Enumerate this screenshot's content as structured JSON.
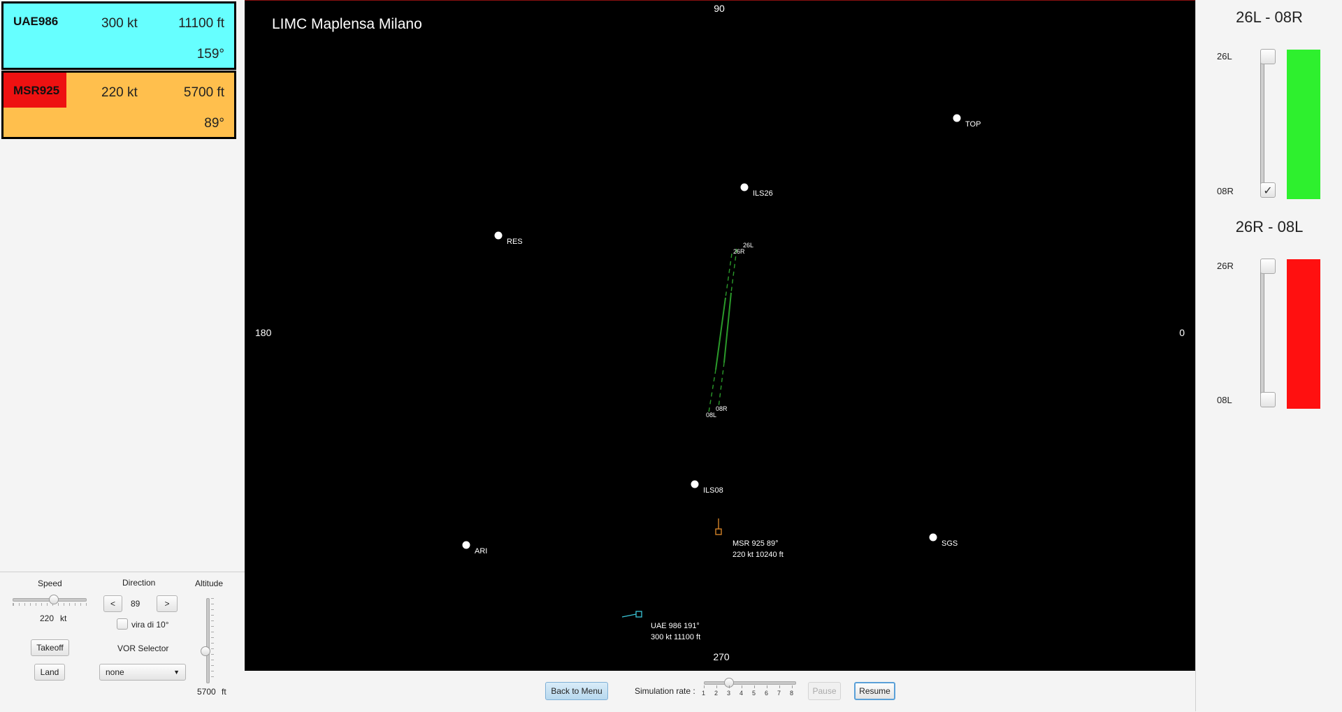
{
  "strips": [
    {
      "callsign": "UAE986",
      "speed": "300 kt",
      "altitude": "11100 ft",
      "heading": "159°",
      "bg": "#66ffff",
      "callsign_bg": "#66ffff"
    },
    {
      "callsign": "MSR925",
      "speed": "220 kt",
      "altitude": "5700 ft",
      "heading": "89°",
      "bg": "#ffbf4d",
      "callsign_bg": "#ee1111"
    }
  ],
  "controls": {
    "speed_label": "Speed",
    "speed_value": "220",
    "speed_unit": "kt",
    "direction_label": "Direction",
    "direction_value": "89",
    "direction_dec": "<",
    "direction_inc": ">",
    "turn10_label": "vira di 10°",
    "altitude_label": "Altitude",
    "altitude_value": "5700",
    "altitude_unit": "ft",
    "takeoff_label": "Takeoff",
    "land_label": "Land",
    "vor_label": "VOR Selector",
    "vor_value": "none"
  },
  "radar": {
    "title": "LIMC Maplensa Milano",
    "compass": {
      "top": "90",
      "bottom": "270",
      "left": "180",
      "right": "0"
    },
    "waypoints": [
      "TOP",
      "ILS26",
      "RES",
      "ILS08",
      "ARI",
      "SGS"
    ],
    "runway_labels": {
      "r26l": "26L",
      "r26r": "26R",
      "r08r": "08R",
      "r08l": "08L"
    },
    "aircraft": [
      {
        "line1": "MSR 925  89°",
        "line2": "220 kt 10240 ft",
        "color": "#e08a2a"
      },
      {
        "line1": "UAE 986  191°",
        "line2": "300 kt 11100 ft",
        "color": "#3ac6d8"
      }
    ]
  },
  "bottom_bar": {
    "back_label": "Back to Menu",
    "sim_rate_label": "Simulation rate :",
    "sim_rate_ticks": [
      "1",
      "2",
      "3",
      "4",
      "5",
      "6",
      "7",
      "8"
    ],
    "sim_rate_value": 3,
    "pause_label": "Pause",
    "resume_label": "Resume"
  },
  "runways": [
    {
      "title": "26L - 08R",
      "top_label": "26L",
      "bottom_label": "08R",
      "top_checked": false,
      "bottom_checked": true,
      "status_color": "#2ef02e"
    },
    {
      "title": "26R - 08L",
      "top_label": "26R",
      "bottom_label": "08L",
      "top_checked": false,
      "bottom_checked": false,
      "status_color": "#ff1010"
    }
  ],
  "colors": {
    "radar_bg": "#000000",
    "runway_green": "#2a9a2a",
    "ui_bg": "#f4f4f4"
  }
}
